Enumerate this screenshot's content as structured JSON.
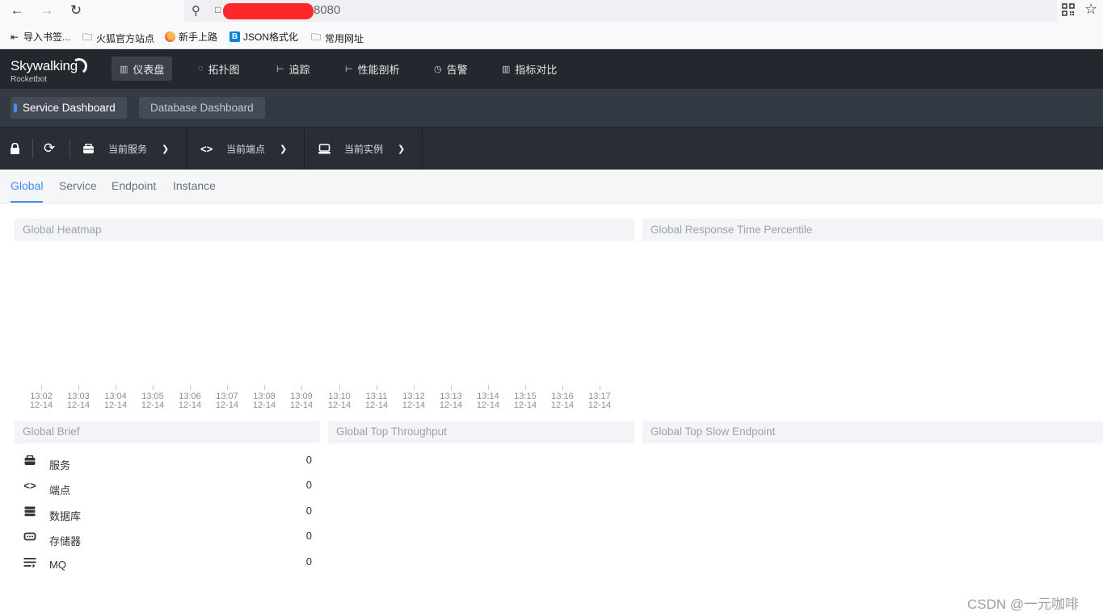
{
  "browser": {
    "url_suffix": "8080",
    "bookmarks": [
      {
        "label": "导入书签...",
        "icon": "import-icon"
      },
      {
        "label": "火狐官方站点",
        "icon": "folder-icon"
      },
      {
        "label": "新手上路",
        "icon": "firefox-icon"
      },
      {
        "label": "JSON格式化",
        "icon": "json-icon"
      },
      {
        "label": "常用网址",
        "icon": "folder-icon"
      }
    ]
  },
  "app": {
    "logo": "Skywalking",
    "logo_sub": "Rocketbot",
    "nav": [
      {
        "label": "仪表盘",
        "icon": "chart-icon",
        "active": true
      },
      {
        "label": "拓扑图",
        "icon": "topology-icon",
        "active": false
      },
      {
        "label": "追踪",
        "icon": "trace-icon",
        "active": false
      },
      {
        "label": "性能剖析",
        "icon": "profile-icon",
        "active": false
      },
      {
        "label": "告警",
        "icon": "alarm-icon",
        "active": false
      },
      {
        "label": "指标对比",
        "icon": "compare-icon",
        "active": false
      }
    ],
    "dashboards": [
      {
        "label": "Service Dashboard",
        "active": true
      },
      {
        "label": "Database Dashboard",
        "active": false
      }
    ],
    "selectors": [
      {
        "label": "当前服务",
        "icon": "service-icon"
      },
      {
        "label": "当前端点",
        "icon": "endpoint-icon"
      },
      {
        "label": "当前实例",
        "icon": "instance-icon"
      }
    ],
    "tabs": [
      {
        "label": "Global",
        "active": true
      },
      {
        "label": "Service",
        "active": false
      },
      {
        "label": "Endpoint",
        "active": false
      },
      {
        "label": "Instance",
        "active": false
      }
    ]
  },
  "panels": {
    "heatmap": "Global Heatmap",
    "response_percentile": "Global Response Time Percentile",
    "brief": "Global Brief",
    "throughput": "Global Top Throughput",
    "slow_endpoint": "Global Top Slow Endpoint"
  },
  "chart_data": {
    "type": "heatmap",
    "title": "Global Heatmap",
    "categories": [
      "13:02",
      "13:03",
      "13:04",
      "13:05",
      "13:06",
      "13:07",
      "13:08",
      "13:09",
      "13:10",
      "13:11",
      "13:12",
      "13:13",
      "13:14",
      "13:15",
      "13:16",
      "13:17"
    ],
    "date": "12-14",
    "values": []
  },
  "brief": [
    {
      "label": "服务",
      "value": "0",
      "icon": "service-icon"
    },
    {
      "label": "端点",
      "value": "0",
      "icon": "endpoint-icon"
    },
    {
      "label": "数据库",
      "value": "0",
      "icon": "database-icon"
    },
    {
      "label": "存储器",
      "value": "0",
      "icon": "storage-icon"
    },
    {
      "label": "MQ",
      "value": "0",
      "icon": "mq-icon"
    }
  ],
  "watermark": "CSDN @一元咖啡"
}
